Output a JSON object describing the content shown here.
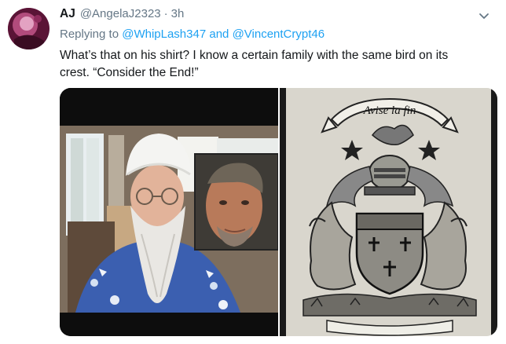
{
  "tweet": {
    "author_name": "AJ",
    "author_handle": "@AngelaJ2323",
    "separator": "·",
    "timestamp": "3h",
    "reply_prefix": "Replying to",
    "reply_mention_1": "@WhipLash347",
    "reply_joiner": "and",
    "reply_mention_2": "@VincentCrypt46",
    "text_line_1": "What’s that on his shirt? I know a certain family with the same bird on its",
    "text_line_2": "crest. “Consider the End!”"
  },
  "media": {
    "crest_motto": "Avise la fin"
  },
  "icons": {
    "more": "chevron-down-icon"
  },
  "colors": {
    "link": "#1da1f2",
    "secondary_text": "#657786",
    "primary_text": "#14171a"
  }
}
